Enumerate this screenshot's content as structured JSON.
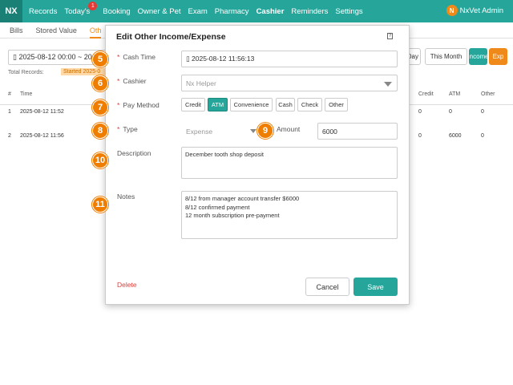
{
  "nav": {
    "logo": "NX",
    "items": [
      "Records",
      "Today's",
      "Booking",
      "Owner & Pet",
      "Exam",
      "Pharmacy",
      "Cashier",
      "Reminders",
      "Settings"
    ],
    "badge": "1",
    "user_initial": "N",
    "user_name": "NxVet Admin"
  },
  "subtabs": [
    "Bills",
    "Stored Value",
    "Oth"
  ],
  "background": {
    "date_range": "▯ 2025-08-12 00:00 ~ 20",
    "total_records": "Total Records:",
    "started": "Started 2025-0",
    "btn_day": "Day",
    "btn_month": "This Month",
    "btn_income": "Income",
    "btn_exp": "Exp",
    "headers": {
      "num": "#",
      "time": "Time",
      "credit": "Credit",
      "atm": "ATM",
      "other": "Other"
    },
    "rows": [
      {
        "num": "1",
        "time": "2025-08-12 11:52",
        "credit": "0",
        "atm": "0",
        "other": "0"
      },
      {
        "num": "2",
        "time": "2025-08-12 11:56",
        "credit": "0",
        "atm": "6000",
        "other": "0"
      }
    ]
  },
  "modal": {
    "title": "Edit Other Income/Expense",
    "help": "?",
    "cash_time_label": "Cash Time",
    "cash_time_value": "▯ 2025-08-12 11:56:13",
    "cashier_label": "Cashier",
    "cashier_value": "Nx Helper",
    "pay_method_label": "Pay Method",
    "pay_methods": [
      "Credit",
      "ATM",
      "Convenience",
      "Cash",
      "Check",
      "Other"
    ],
    "pay_method_selected": "ATM",
    "type_label": "Type",
    "type_value": "Expense",
    "amount_label": "Amount",
    "amount_value": "6000",
    "description_label": "Description",
    "description_value": "December tooth shop deposit",
    "notes_label": "Notes",
    "notes_value": "8/12 from manager account transfer $6000\n8/12 confirmed payment\n12 month subscription pre-payment",
    "delete_label": "Delete",
    "cancel_label": "Cancel",
    "save_label": "Save",
    "required_mark": "*"
  },
  "steps": [
    "5",
    "6",
    "7",
    "8",
    "9",
    "10",
    "11"
  ],
  "colors": {
    "primary": "#26a69a",
    "accent": "#ef7d00",
    "danger": "#e53935"
  }
}
